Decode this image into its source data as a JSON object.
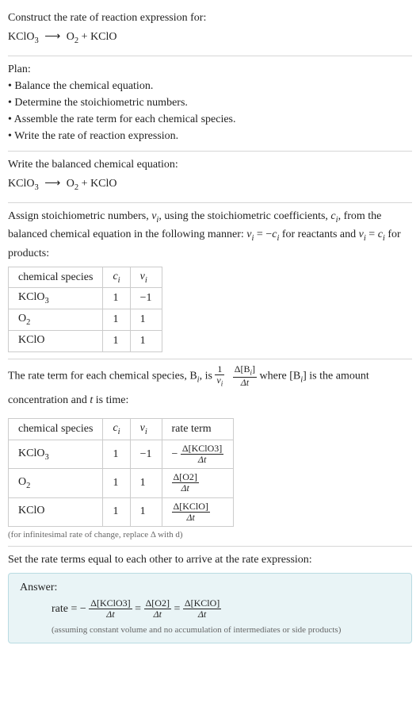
{
  "header": {
    "prompt": "Construct the rate of reaction expression for:",
    "equation_lhs": "KClO",
    "equation_lhs_sub": "3",
    "arrow": "⟶",
    "equation_rhs_a": "O",
    "equation_rhs_a_sub": "2",
    "plus": " + ",
    "equation_rhs_b": "KClO"
  },
  "plan": {
    "title": "Plan:",
    "items": [
      "• Balance the chemical equation.",
      "• Determine the stoichiometric numbers.",
      "• Assemble the rate term for each chemical species.",
      "• Write the rate of reaction expression."
    ]
  },
  "balanced": {
    "title": "Write the balanced chemical equation:",
    "equation_lhs": "KClO",
    "equation_lhs_sub": "3",
    "arrow": "⟶",
    "equation_rhs_a": "O",
    "equation_rhs_a_sub": "2",
    "plus": " + ",
    "equation_rhs_b": "KClO"
  },
  "stoich": {
    "intro_a": "Assign stoichiometric numbers, ",
    "nu_i": "ν",
    "i_sub": "i",
    "intro_b": ", using the stoichiometric coefficients, ",
    "c_i": "c",
    "intro_c": ", from the balanced chemical equation in the following manner: ",
    "rel_react_lhs": "ν",
    "rel_eq": " = −",
    "rel_react_rhs": "c",
    "rel_react_tail": " for reactants and ",
    "rel_prod_lhs": "ν",
    "rel_prod_eq": " = ",
    "rel_prod_rhs": "c",
    "rel_prod_tail": " for products:",
    "table": {
      "headers": [
        "chemical species",
        "cᵢ",
        "νᵢ"
      ],
      "rows": [
        {
          "species": "KClO",
          "species_sub": "3",
          "c": "1",
          "nu": "−1"
        },
        {
          "species": "O",
          "species_sub": "2",
          "c": "1",
          "nu": "1"
        },
        {
          "species": "KClO",
          "species_sub": "",
          "c": "1",
          "nu": "1"
        }
      ]
    }
  },
  "rate_term": {
    "intro_a": "The rate term for each chemical species, B",
    "intro_b": ", is ",
    "frac1_num": "1",
    "frac1_den_sym": "ν",
    "frac2_num_a": "Δ[B",
    "frac2_num_b": "]",
    "frac2_den": "Δt",
    "intro_c": " where [B",
    "intro_d": "] is the amount concentration and ",
    "t_var": "t",
    "intro_e": " is time:",
    "table": {
      "headers": [
        "chemical species",
        "cᵢ",
        "νᵢ",
        "rate term"
      ],
      "rows": [
        {
          "species": "KClO",
          "species_sub": "3",
          "c": "1",
          "nu": "−1",
          "rt_sign": "−",
          "rt_num": "Δ[KClO3]",
          "rt_den": "Δt"
        },
        {
          "species": "O",
          "species_sub": "2",
          "c": "1",
          "nu": "1",
          "rt_sign": "",
          "rt_num": "Δ[O2]",
          "rt_den": "Δt"
        },
        {
          "species": "KClO",
          "species_sub": "",
          "c": "1",
          "nu": "1",
          "rt_sign": "",
          "rt_num": "Δ[KClO]",
          "rt_den": "Δt"
        }
      ]
    },
    "note": "(for infinitesimal rate of change, replace Δ with d)"
  },
  "final": {
    "intro": "Set the rate terms equal to each other to arrive at the rate expression:",
    "answer_title": "Answer:",
    "rate_label": "rate = −",
    "t1_num": "Δ[KClO3]",
    "t1_den": "Δt",
    "eq": " = ",
    "t2_num": "Δ[O2]",
    "t2_den": "Δt",
    "t3_num": "Δ[KClO]",
    "t3_den": "Δt",
    "note": "(assuming constant volume and no accumulation of intermediates or side products)"
  }
}
